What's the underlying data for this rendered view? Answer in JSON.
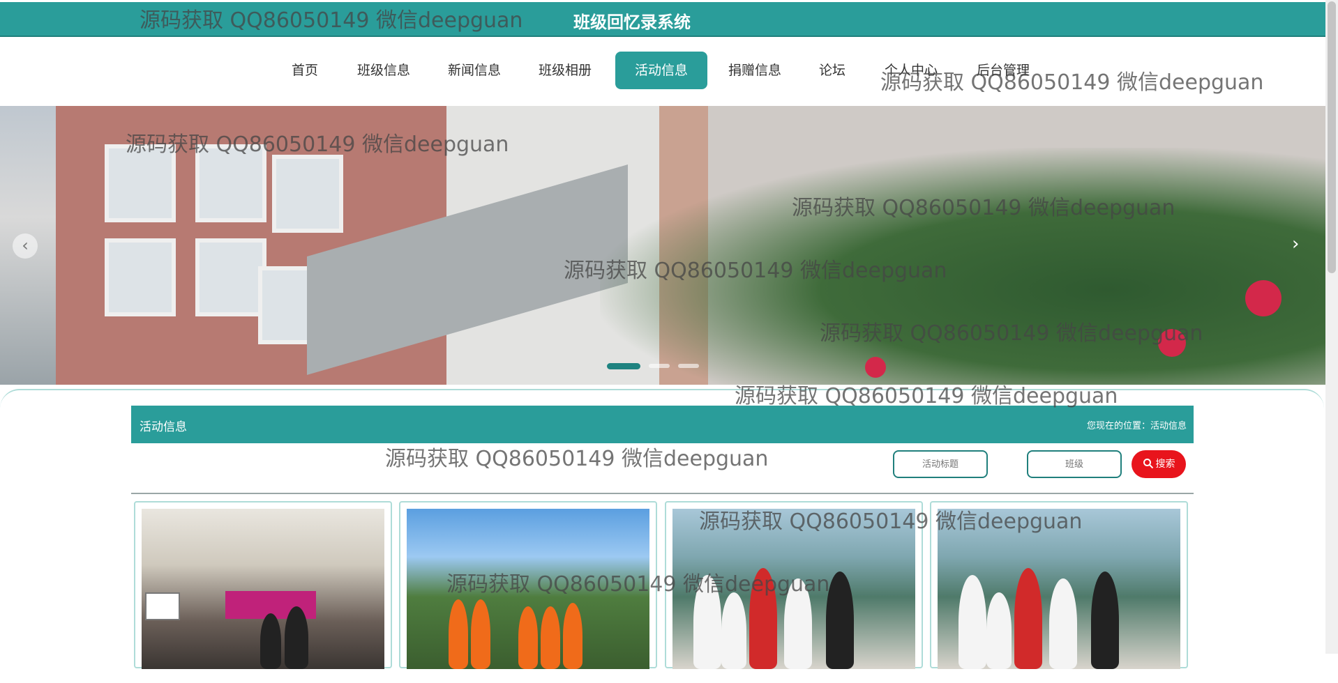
{
  "header": {
    "title": "班级回忆录系统"
  },
  "nav": {
    "items": [
      {
        "label": "首页"
      },
      {
        "label": "班级信息"
      },
      {
        "label": "新闻信息"
      },
      {
        "label": "班级相册"
      },
      {
        "label": "活动信息",
        "active": true
      },
      {
        "label": "捐赠信息"
      },
      {
        "label": "论坛"
      },
      {
        "label": "个人中心"
      },
      {
        "label": "后台管理"
      }
    ]
  },
  "banner": {
    "slide_count": 3,
    "active_slide": 1
  },
  "section": {
    "title": "活动信息",
    "breadcrumb": "您现在的位置：活动信息"
  },
  "search": {
    "title_placeholder": "活动标题",
    "class_placeholder": "班级",
    "button_label": "搜索"
  },
  "watermark": "源码获取 QQ86050149 微信deepguan",
  "colors": {
    "primary": "#2a9d9a",
    "search_button": "#e8141c"
  }
}
